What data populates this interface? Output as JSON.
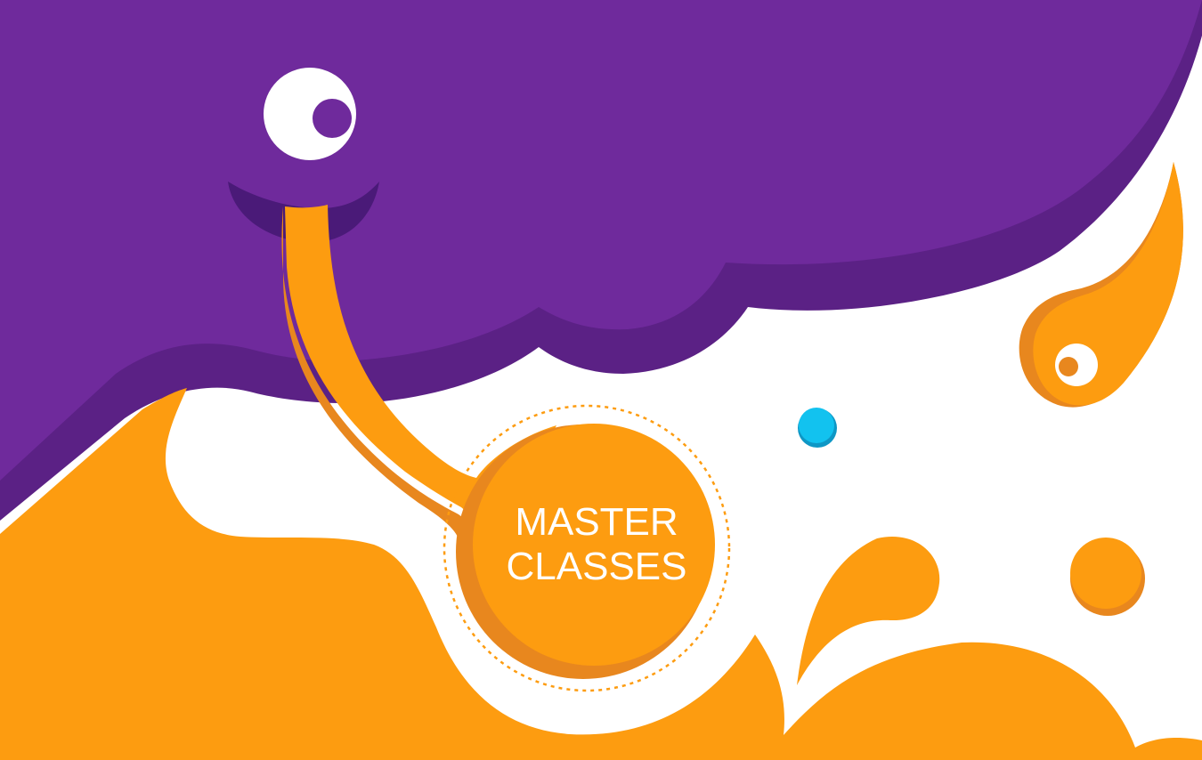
{
  "badge": {
    "line1": "MASTER",
    "line2": "CLASSES"
  },
  "colors": {
    "purple": "#6f2a9c",
    "purple_shadow": "#5b2185",
    "purple_dark": "#4a1a78",
    "orange": "#fd9c10",
    "orange_shadow": "#e8871e",
    "cyan": "#12c2ef",
    "cyan_shadow": "#0e97c5",
    "white": "#ffffff"
  },
  "icons": {
    "main_eye": "eye-icon",
    "small_eye": "eye-icon",
    "blue_bubble": "bubble-icon",
    "orange_bubble": "bubble-icon"
  }
}
